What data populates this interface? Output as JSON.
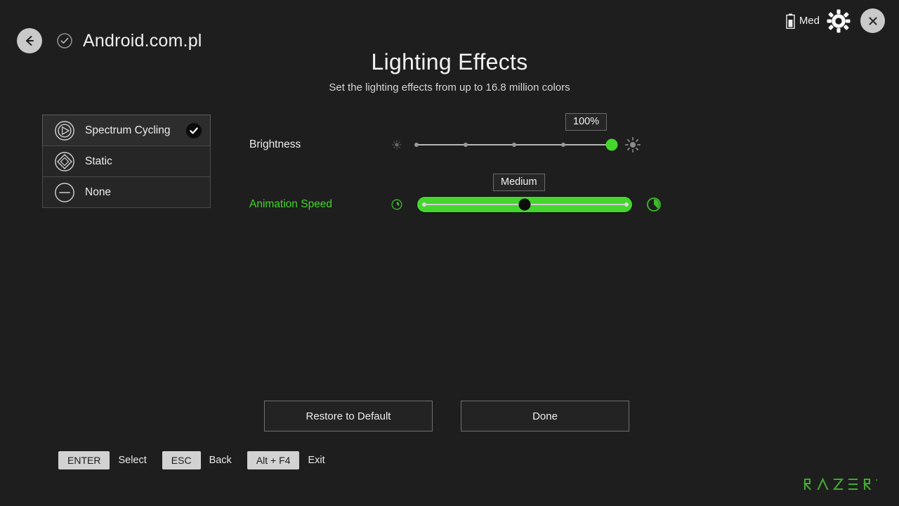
{
  "topbar": {
    "back_icon": "back-arrow-icon",
    "verified_icon": "verified-check-icon",
    "site_title": "Android.com.pl",
    "battery_icon": "battery-icon",
    "battery_label": "Med",
    "settings_icon": "gear-icon",
    "close_icon": "close-icon"
  },
  "header": {
    "title": "Lighting Effects",
    "subtitle": "Set the lighting effects from up to 16.8 million colors"
  },
  "effects": {
    "items": [
      {
        "label": "Spectrum Cycling",
        "icon": "spectrum-cycling-icon",
        "selected": true
      },
      {
        "label": "Static",
        "icon": "static-icon",
        "selected": false
      },
      {
        "label": "None",
        "icon": "none-icon",
        "selected": false
      }
    ]
  },
  "controls": {
    "brightness": {
      "label": "Brightness",
      "value": "100%",
      "value_pct": 100,
      "min_icon": "brightness-low-icon",
      "max_icon": "brightness-high-icon",
      "focused": false
    },
    "animation_speed": {
      "label": "Animation Speed",
      "value": "Medium",
      "value_pct": 50,
      "min_icon": "speed-slow-clock-icon",
      "max_icon": "speed-fast-clock-icon",
      "focused": true
    }
  },
  "actions": {
    "restore": "Restore to Default",
    "done": "Done"
  },
  "hints": [
    {
      "key": "ENTER",
      "action": "Select"
    },
    {
      "key": "ESC",
      "action": "Back"
    },
    {
      "key": "Alt + F4",
      "action": "Exit"
    }
  ],
  "brand": {
    "name": "RAZER"
  },
  "colors": {
    "accent_green": "#44d62c",
    "background": "#1e1e1e",
    "panel": "#262626"
  }
}
